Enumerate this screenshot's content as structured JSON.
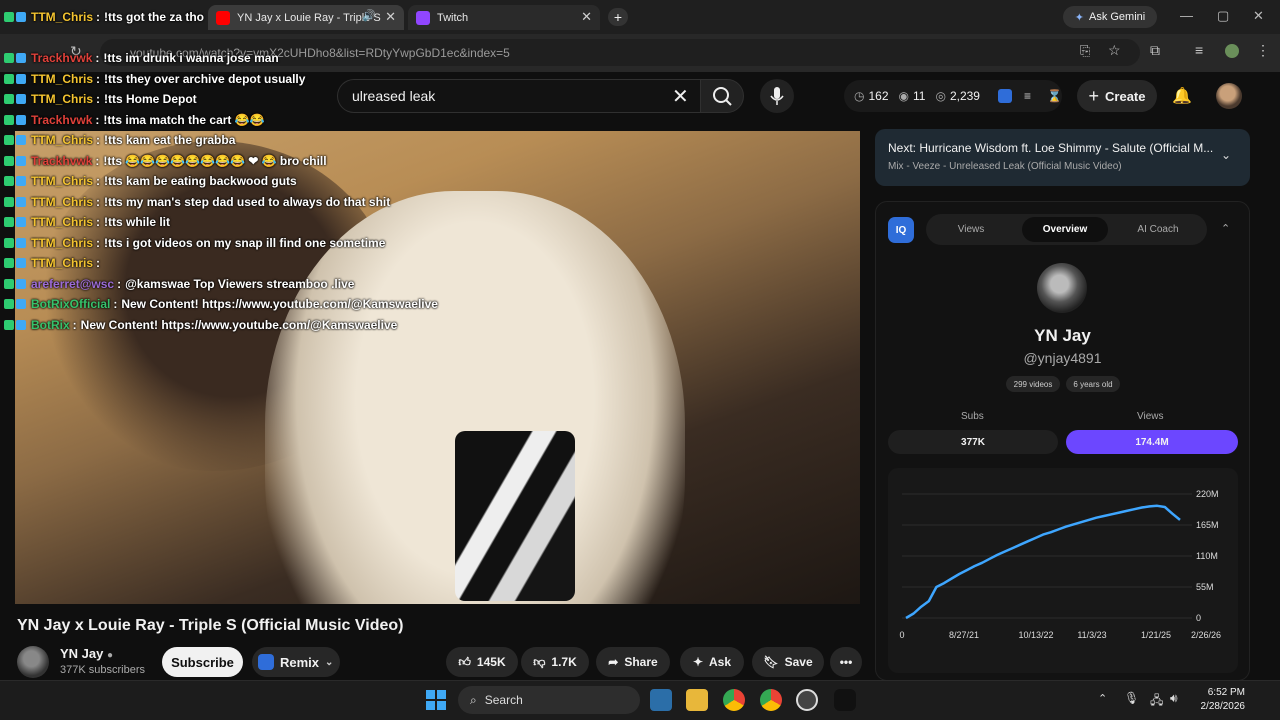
{
  "browser": {
    "tabs": [
      {
        "label": "YN Jay x Louie Ray - Triple S",
        "active": true
      },
      {
        "label": "Twitch",
        "active": false
      }
    ],
    "ask_gemini": "Ask Gemini",
    "url": "youtube.com/watch?v=vmX2cUHDho8&list=RDtyYwpGbD1ec&index=5"
  },
  "youtube": {
    "search_value": "ulreased leak",
    "ext_stats": {
      "a": "162",
      "b": "11",
      "c": "2,239"
    },
    "create_label": "Create"
  },
  "chat": [
    {
      "user": "TTM_Chris",
      "text": "!tts got the za tho",
      "color": "#f4c430"
    },
    {
      "user": "",
      "text": "youtube.com/watch?v=vmX2cUHDho8&list=RDtyYwpGbD1ec&index=5",
      "color": "#f4c430",
      "hidden": true
    },
    {
      "user": "Trackhvwk",
      "text": "!tts im drunk i wanna jose man",
      "color": "#e0413a"
    },
    {
      "user": "TTM_Chris",
      "text": "!tts they over archive depot usually",
      "color": "#f4c430"
    },
    {
      "user": "TTM_Chris",
      "text": "!tts Home Depot",
      "color": "#f4c430"
    },
    {
      "user": "Trackhvwk",
      "text": "!tts ima match the cart 😂😂",
      "color": "#e0413a"
    },
    {
      "user": "TTM_Chris",
      "text": "!tts kam eat the grabba",
      "color": "#f4c430"
    },
    {
      "user": "Trackhvwk",
      "text": "!tts 😂😂😂😂😂😂😂😂 ❤ 😂 bro chill",
      "color": "#e0413a"
    },
    {
      "user": "TTM_Chris",
      "text": "!tts kam be eating backwood guts",
      "color": "#f4c430"
    },
    {
      "user": "TTM_Chris",
      "text": "!tts my man's step dad used to always do that shit",
      "color": "#f4c430"
    },
    {
      "user": "TTM_Chris",
      "text": "!tts while lit",
      "color": "#f4c430"
    },
    {
      "user": "TTM_Chris",
      "text": "!tts i got videos on my snap ill find one sometime",
      "color": "#f4c430"
    },
    {
      "user": "TTM_Chris",
      "text": "",
      "color": "#f4c430"
    },
    {
      "user": "areferret@wsc",
      "text": "@kamswae Top Viewers streamboo .live",
      "color": "#9b6bd6"
    },
    {
      "user": "BotRixOfficial",
      "text": "New Content! https://www.youtube.com/@Kamswaelive",
      "color": "#36c26b"
    },
    {
      "user": "BotRix",
      "text": "New Content! https://www.youtube.com/@Kamswaelive",
      "color": "#36c26b"
    }
  ],
  "video": {
    "title": "YN Jay x Louie Ray - Triple S (Official Music Video)",
    "channel": "YN Jay",
    "subscribers": "377K subscribers",
    "subscribe_label": "Subscribe",
    "remix_label": "Remix",
    "likes": "145K",
    "dislikes": "1.7K",
    "share_label": "Share",
    "ask_label": "Ask",
    "save_label": "Save"
  },
  "next": {
    "title": "Next: Hurricane Wisdom ft. Loe Shimmy - Salute (Official M...",
    "subtitle": "Mix - Veeze - Unreleased Leak (Official Music Video)"
  },
  "panel": {
    "logo": "IQ",
    "tabs": [
      "Views",
      "Overview",
      "AI Coach"
    ],
    "active_tab": "Overview",
    "channel_name": "YN Jay",
    "handle": "@ynjay4891",
    "videos": "299 videos",
    "age": "6 years old",
    "subs_label": "Subs",
    "subs_value": "377K",
    "views_label": "Views",
    "views_value": "174.4M",
    "accent": "#6c47ff"
  },
  "chart_data": {
    "type": "line",
    "x_ticks": [
      "0",
      "8/27/21",
      "10/13/22",
      "11/3/23",
      "1/21/25",
      "2/26/26"
    ],
    "y_ticks": [
      "0",
      "55M",
      "110M",
      "165M",
      "220M"
    ],
    "ylim": [
      0,
      220
    ],
    "series": [
      {
        "values": [
          0,
          8,
          20,
          30,
          55,
          62,
          70,
          78,
          85,
          92,
          98,
          105,
          112,
          118,
          124,
          130,
          136,
          142,
          148,
          152,
          157,
          162,
          166,
          170,
          174,
          178,
          181,
          184,
          187,
          190,
          193,
          196,
          198,
          199,
          197,
          185,
          174
        ]
      }
    ],
    "color": "#3ea6ff"
  },
  "taskbar": {
    "search_label": "Search",
    "time": "6:52 PM",
    "date": "2/28/2026"
  }
}
